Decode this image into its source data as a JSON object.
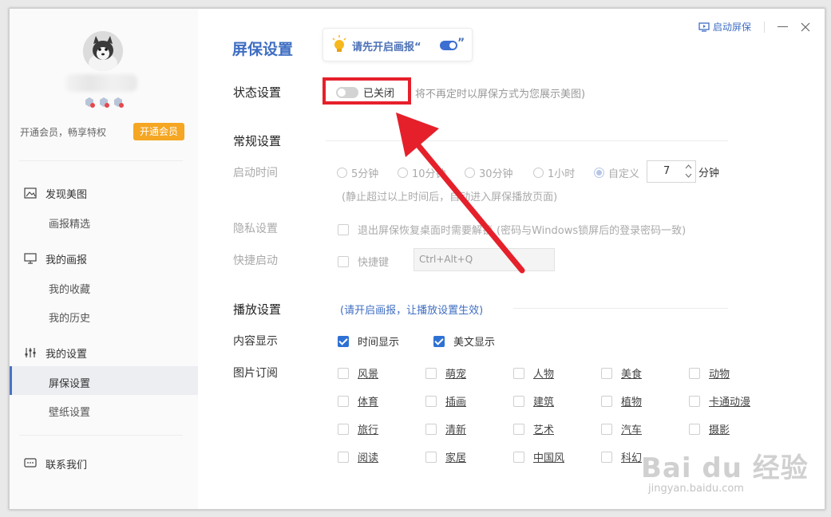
{
  "titlebar": {
    "screensaver_btn": "启动屏保"
  },
  "user": {
    "vip_text": "开通会员，畅享特权",
    "vip_btn": "开通会员"
  },
  "nav": {
    "discover": "发现美图",
    "picks": "画报精选",
    "my_pictorial": "我的画报",
    "favorites": "我的收藏",
    "history": "我的历史",
    "settings": "我的设置",
    "screensaver": "屏保设置",
    "wallpaper": "壁纸设置",
    "contact": "联系我们"
  },
  "page": {
    "title": "屏保设置",
    "tip_text": "请先开启画报“",
    "tip_close": "”"
  },
  "status": {
    "label": "状态设置",
    "toggle_text": "已关闭",
    "hint": "将不再定时以屏保方式为您展示美图)"
  },
  "general": {
    "title": "常规设置",
    "start_label": "启动时间",
    "options": [
      "5分钟",
      "10分钟",
      "30分钟",
      "1小时",
      "自定义"
    ],
    "custom_value": "7",
    "unit": "分钟",
    "start_hint": "(静止超过以上时间后，自动进入屏保播放页面)",
    "privacy_label": "隐私设置",
    "privacy_text": "退出屏保恢复桌面时需要解锁",
    "privacy_hint": "(密码与Windows锁屏后的登录密码一致)",
    "quick_label": "快捷启动",
    "quick_text": "快捷键",
    "shortcut_value": "Ctrl+Alt+Q"
  },
  "play": {
    "title": "播放设置",
    "hint": "(请开启画报，让播放设置生效)",
    "content_label": "内容显示",
    "time_show": "时间显示",
    "article_show": "美文显示",
    "sub_label": "图片订阅",
    "categories": [
      [
        "风景",
        "萌宠",
        "人物",
        "美食",
        "动物"
      ],
      [
        "体育",
        "插画",
        "建筑",
        "植物",
        "卡通动漫"
      ],
      [
        "旅行",
        "清新",
        "艺术",
        "汽车",
        "摄影"
      ],
      [
        "阅读",
        "家居",
        "中国风",
        "科幻"
      ]
    ]
  },
  "watermark": {
    "brand": "Bai du 经验",
    "url": "jingyan.baidu.com"
  },
  "colors": {
    "accent": "#3f6ec2",
    "vip": "#f5a623",
    "highlight": "#e5202b"
  }
}
